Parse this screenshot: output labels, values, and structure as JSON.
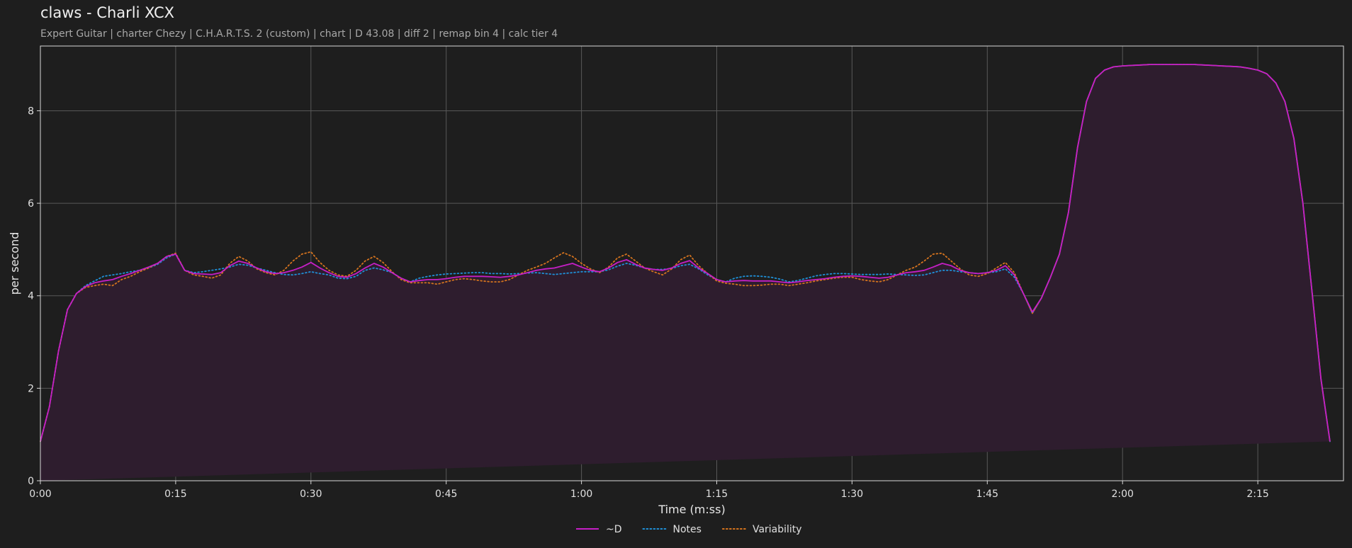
{
  "header": {
    "title": "claws - Charli XCX",
    "subtitle": "Expert Guitar  |  charter Chezy  |  C.H.A.R.T.S. 2 (custom)  |  chart  |  D 43.08  |  diff 2  |  remap bin 4  |  calc tier 4"
  },
  "chart_data": {
    "type": "line",
    "title": "claws - Charli XCX",
    "xlabel": "Time (m:ss)",
    "ylabel": "per second",
    "xlim": [
      0,
      144.5
    ],
    "ylim": [
      0,
      9.4
    ],
    "x_ticks": [
      {
        "value": 0,
        "label": "0:00"
      },
      {
        "value": 15,
        "label": "0:15"
      },
      {
        "value": 30,
        "label": "0:30"
      },
      {
        "value": 45,
        "label": "0:45"
      },
      {
        "value": 60,
        "label": "1:00"
      },
      {
        "value": 75,
        "label": "1:15"
      },
      {
        "value": 90,
        "label": "1:30"
      },
      {
        "value": 105,
        "label": "1:45"
      },
      {
        "value": 120,
        "label": "2:00"
      },
      {
        "value": 135,
        "label": "2:15"
      }
    ],
    "y_ticks": [
      {
        "value": 0,
        "label": "0"
      },
      {
        "value": 2,
        "label": "2"
      },
      {
        "value": 4,
        "label": "4"
      },
      {
        "value": 6,
        "label": "6"
      },
      {
        "value": 8,
        "label": "8"
      }
    ],
    "grid": true,
    "legend_position": "bottom-center",
    "x": [
      0,
      1,
      2,
      3,
      4,
      5,
      6,
      7,
      8,
      9,
      10,
      11,
      12,
      13,
      14,
      15,
      16,
      17,
      18,
      19,
      20,
      21,
      22,
      23,
      24,
      25,
      26,
      27,
      28,
      29,
      30,
      31,
      32,
      33,
      34,
      35,
      36,
      37,
      38,
      39,
      40,
      41,
      42,
      43,
      44,
      45,
      46,
      47,
      48,
      49,
      50,
      51,
      52,
      53,
      54,
      55,
      56,
      57,
      58,
      59,
      60,
      61,
      62,
      63,
      64,
      65,
      66,
      67,
      68,
      69,
      70,
      71,
      72,
      73,
      74,
      75,
      76,
      77,
      78,
      79,
      80,
      81,
      82,
      83,
      84,
      85,
      86,
      87,
      88,
      89,
      90,
      91,
      92,
      93,
      94,
      95,
      96,
      97,
      98,
      99,
      100,
      101,
      102,
      103,
      104,
      105,
      106,
      107,
      108,
      109,
      110,
      111,
      112,
      113,
      114,
      115,
      116,
      117,
      118,
      119,
      120,
      121,
      122,
      123,
      124,
      125,
      126,
      127,
      128,
      129,
      130,
      131,
      132,
      133,
      134,
      135,
      136,
      137,
      138,
      139,
      140,
      141,
      142,
      143,
      144,
      144.5
    ],
    "series": [
      {
        "name": "~D",
        "color": "#c61fc6",
        "style": "solid",
        "values": [
          0.85,
          1.6,
          2.8,
          3.7,
          4.05,
          4.2,
          4.28,
          4.32,
          4.35,
          4.42,
          4.48,
          4.55,
          4.62,
          4.7,
          4.85,
          4.9,
          4.55,
          4.48,
          4.47,
          4.46,
          4.5,
          4.65,
          4.75,
          4.7,
          4.6,
          4.52,
          4.48,
          4.5,
          4.55,
          4.62,
          4.72,
          4.6,
          4.5,
          4.42,
          4.4,
          4.48,
          4.6,
          4.7,
          4.62,
          4.5,
          4.38,
          4.3,
          4.33,
          4.35,
          4.35,
          4.37,
          4.4,
          4.42,
          4.42,
          4.42,
          4.41,
          4.4,
          4.42,
          4.45,
          4.5,
          4.55,
          4.58,
          4.6,
          4.65,
          4.7,
          4.62,
          4.55,
          4.52,
          4.6,
          4.72,
          4.78,
          4.68,
          4.6,
          4.57,
          4.55,
          4.6,
          4.7,
          4.76,
          4.6,
          4.48,
          4.35,
          4.3,
          4.32,
          4.33,
          4.32,
          4.32,
          4.32,
          4.3,
          4.28,
          4.3,
          4.33,
          4.35,
          4.37,
          4.4,
          4.42,
          4.43,
          4.42,
          4.4,
          4.38,
          4.4,
          4.45,
          4.5,
          4.52,
          4.55,
          4.62,
          4.7,
          4.65,
          4.55,
          4.5,
          4.48,
          4.5,
          4.55,
          4.65,
          4.45,
          4.05,
          3.65,
          3.95,
          4.4,
          4.9,
          5.8,
          7.2,
          8.2,
          8.7,
          8.88,
          8.95,
          8.97,
          8.98,
          8.99,
          9.0,
          9.0,
          9.0,
          9.0,
          9.0,
          9.0,
          8.99,
          8.98,
          8.97,
          8.96,
          8.95,
          8.92,
          8.88,
          8.8,
          8.6,
          8.2,
          7.4,
          6.0,
          4.1,
          2.2,
          0.85
        ]
      },
      {
        "name": "Notes",
        "color": "#1f8fd6",
        "style": "dotted",
        "values": [
          0.85,
          1.6,
          2.8,
          3.7,
          4.05,
          4.22,
          4.32,
          4.42,
          4.45,
          4.48,
          4.52,
          4.55,
          4.6,
          4.68,
          4.82,
          4.9,
          4.55,
          4.5,
          4.52,
          4.55,
          4.58,
          4.62,
          4.68,
          4.66,
          4.6,
          4.55,
          4.5,
          4.46,
          4.45,
          4.48,
          4.52,
          4.48,
          4.45,
          4.38,
          4.37,
          4.42,
          4.55,
          4.6,
          4.56,
          4.5,
          4.38,
          4.3,
          4.38,
          4.42,
          4.45,
          4.47,
          4.48,
          4.49,
          4.5,
          4.5,
          4.48,
          4.48,
          4.47,
          4.48,
          4.49,
          4.5,
          4.48,
          4.46,
          4.48,
          4.5,
          4.52,
          4.52,
          4.52,
          4.56,
          4.64,
          4.7,
          4.66,
          4.6,
          4.57,
          4.57,
          4.59,
          4.65,
          4.68,
          4.58,
          4.45,
          4.35,
          4.3,
          4.38,
          4.42,
          4.43,
          4.42,
          4.4,
          4.36,
          4.3,
          4.33,
          4.38,
          4.43,
          4.46,
          4.48,
          4.48,
          4.47,
          4.46,
          4.46,
          4.46,
          4.47,
          4.46,
          4.45,
          4.44,
          4.45,
          4.5,
          4.55,
          4.55,
          4.52,
          4.5,
          4.48,
          4.5,
          4.52,
          4.58,
          4.4,
          4.05,
          3.62,
          3.95,
          4.4,
          4.9,
          5.8,
          7.2,
          8.2,
          8.7,
          8.88,
          8.95,
          8.97,
          8.98,
          8.99,
          9.0,
          9.0,
          9.0,
          9.0,
          9.0,
          9.0,
          8.99,
          8.98,
          8.97,
          8.96,
          8.95,
          8.92,
          8.88,
          8.8,
          8.6,
          8.2,
          7.4,
          6.0,
          4.1,
          2.2,
          0.85
        ]
      },
      {
        "name": "Variability",
        "color": "#d4731e",
        "style": "dotted",
        "values": [
          0.85,
          1.6,
          2.8,
          3.7,
          4.05,
          4.18,
          4.22,
          4.25,
          4.22,
          4.35,
          4.42,
          4.52,
          4.6,
          4.7,
          4.85,
          4.92,
          4.55,
          4.45,
          4.42,
          4.38,
          4.45,
          4.7,
          4.85,
          4.75,
          4.58,
          4.5,
          4.45,
          4.55,
          4.75,
          4.9,
          4.95,
          4.72,
          4.55,
          4.45,
          4.42,
          4.55,
          4.75,
          4.85,
          4.72,
          4.52,
          4.35,
          4.28,
          4.28,
          4.28,
          4.25,
          4.3,
          4.35,
          4.37,
          4.35,
          4.32,
          4.3,
          4.3,
          4.35,
          4.45,
          4.55,
          4.62,
          4.7,
          4.82,
          4.93,
          4.85,
          4.7,
          4.58,
          4.5,
          4.62,
          4.82,
          4.9,
          4.75,
          4.6,
          4.52,
          4.45,
          4.58,
          4.78,
          4.88,
          4.65,
          4.48,
          4.32,
          4.27,
          4.25,
          4.22,
          4.22,
          4.23,
          4.25,
          4.25,
          4.22,
          4.25,
          4.28,
          4.32,
          4.35,
          4.38,
          4.4,
          4.4,
          4.35,
          4.32,
          4.3,
          4.35,
          4.45,
          4.55,
          4.62,
          4.75,
          4.9,
          4.92,
          4.75,
          4.58,
          4.45,
          4.42,
          4.48,
          4.6,
          4.72,
          4.5,
          4.05,
          3.62,
          3.95,
          4.4,
          4.9,
          5.8,
          7.2,
          8.2,
          8.7,
          8.88,
          8.95,
          8.97,
          8.98,
          8.99,
          9.0,
          9.0,
          9.0,
          9.0,
          9.0,
          9.0,
          8.99,
          8.98,
          8.97,
          8.96,
          8.95,
          8.92,
          8.88,
          8.8,
          8.6,
          8.2,
          7.4,
          6.0,
          4.1,
          2.2,
          0.85
        ]
      }
    ]
  }
}
